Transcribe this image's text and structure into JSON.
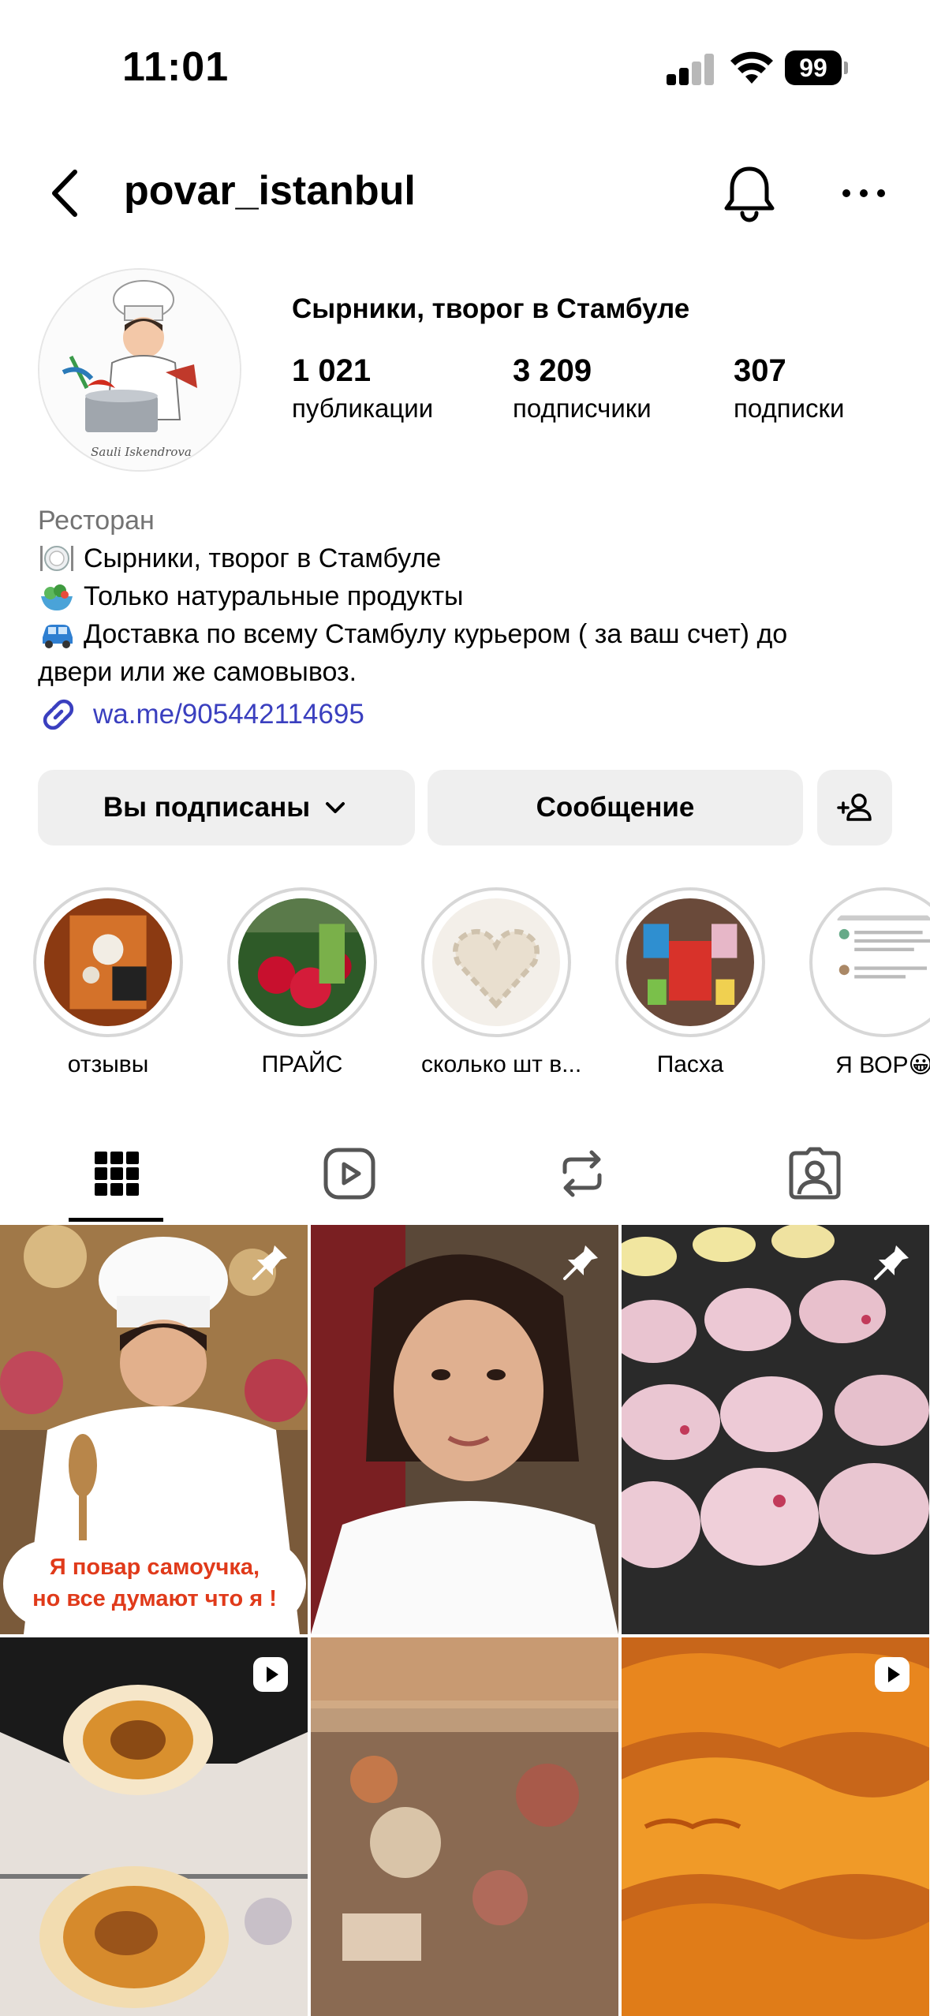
{
  "status_bar": {
    "time": "11:01",
    "battery": "99"
  },
  "header": {
    "username": "povar_istanbul"
  },
  "profile": {
    "display_name": "Сырники, творог в Стамбуле",
    "stats": [
      {
        "value": "1 021",
        "label": "публикации"
      },
      {
        "value": "3 209",
        "label": "подписчики"
      },
      {
        "value": "307",
        "label": "подписки"
      }
    ],
    "category": "Ресторан",
    "bio": [
      "Сырники, творог в Стамбуле",
      "Только натуральные продукты",
      "Доставка по всему Стамбулу курьером ( за ваш счет) до",
      "двери или же самовывоз."
    ],
    "link": "wa.me/905442114695",
    "avatar_signature": "Sauli Iskendrova"
  },
  "actions": {
    "following_label": "Вы подписаны",
    "message_label": "Сообщение"
  },
  "highlights": [
    {
      "label": "отзывы"
    },
    {
      "label": "ПРАЙС"
    },
    {
      "label": "сколько шт в..."
    },
    {
      "label": "Пасха"
    },
    {
      "label": "Я ВОР😀"
    }
  ],
  "tabs": [
    {
      "name": "posts-grid",
      "icon": "grid-icon",
      "active": true
    },
    {
      "name": "reels",
      "icon": "reels-icon",
      "active": false
    },
    {
      "name": "reposts",
      "icon": "repost-icon",
      "active": false
    },
    {
      "name": "tagged",
      "icon": "tagged-icon",
      "active": false
    }
  ],
  "posts": [
    {
      "overlay_line1": "Я повар самоучка,",
      "overlay_line2": "но все думают что я !",
      "pinned": true
    },
    {
      "pinned": true
    },
    {
      "pinned": true
    },
    {
      "reel": true
    },
    {
      "reel": false
    },
    {
      "reel": true
    }
  ],
  "colors": {
    "link": "#3a3fbf",
    "button_bg": "#efefef",
    "overlay_text": "#e03a1a"
  }
}
